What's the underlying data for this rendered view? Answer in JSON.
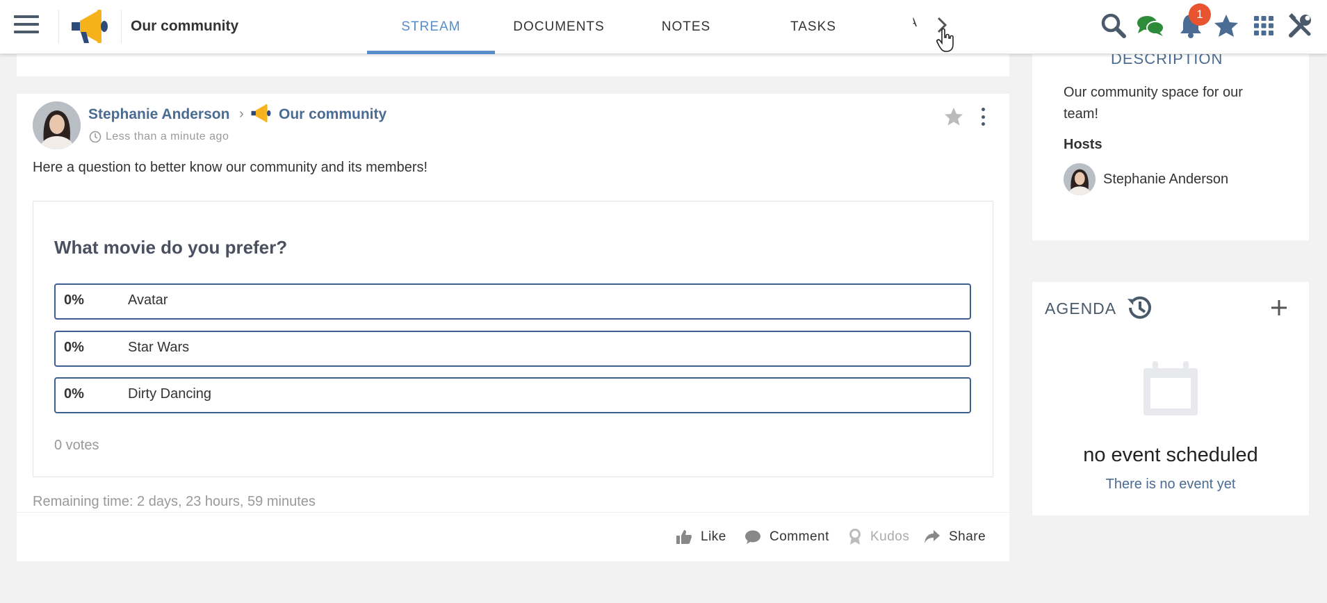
{
  "topbar": {
    "space_name": "Our community",
    "tabs": [
      {
        "label": "STREAM",
        "active": true
      },
      {
        "label": "DOCUMENTS",
        "active": false
      },
      {
        "label": "NOTES",
        "active": false
      },
      {
        "label": "TASKS",
        "active": false
      }
    ],
    "more_tab_fragment": "A",
    "notification_count": "1",
    "icons": [
      "hamburger-menu-icon",
      "megaphone-icon",
      "chevron-right-icon",
      "search-icon",
      "chat-icon",
      "bell-icon",
      "star-icon",
      "apps-grid-icon",
      "tools-icon"
    ]
  },
  "post": {
    "author": "Stephanie Anderson",
    "space": "Our community",
    "time": "Less than a minute ago",
    "text": "Here a question to better know our community and its members!",
    "poll": {
      "question": "What movie do you prefer?",
      "options": [
        {
          "percent": "0%",
          "label": "Avatar"
        },
        {
          "percent": "0%",
          "label": "Star Wars"
        },
        {
          "percent": "0%",
          "label": "Dirty Dancing"
        }
      ],
      "votes": "0 votes"
    },
    "remaining": "Remaining time: 2 days, 23 hours, 59 minutes",
    "actions": {
      "like": "Like",
      "comment": "Comment",
      "kudos": "Kudos",
      "share": "Share"
    }
  },
  "sidebar": {
    "description": {
      "title": "DESCRIPTION",
      "text": "Our community space for our team!",
      "hosts_title": "Hosts",
      "hosts": [
        "Stephanie Anderson"
      ]
    },
    "agenda": {
      "title": "AGENDA",
      "empty_title": "no event scheduled",
      "empty_subtitle": "There is no event yet"
    }
  },
  "colors": {
    "accent": "#578dc9",
    "link": "#4a6b92",
    "poll_border": "#3d5f8f",
    "badge": "#e8542f",
    "megaphone": "#f5b21b"
  }
}
